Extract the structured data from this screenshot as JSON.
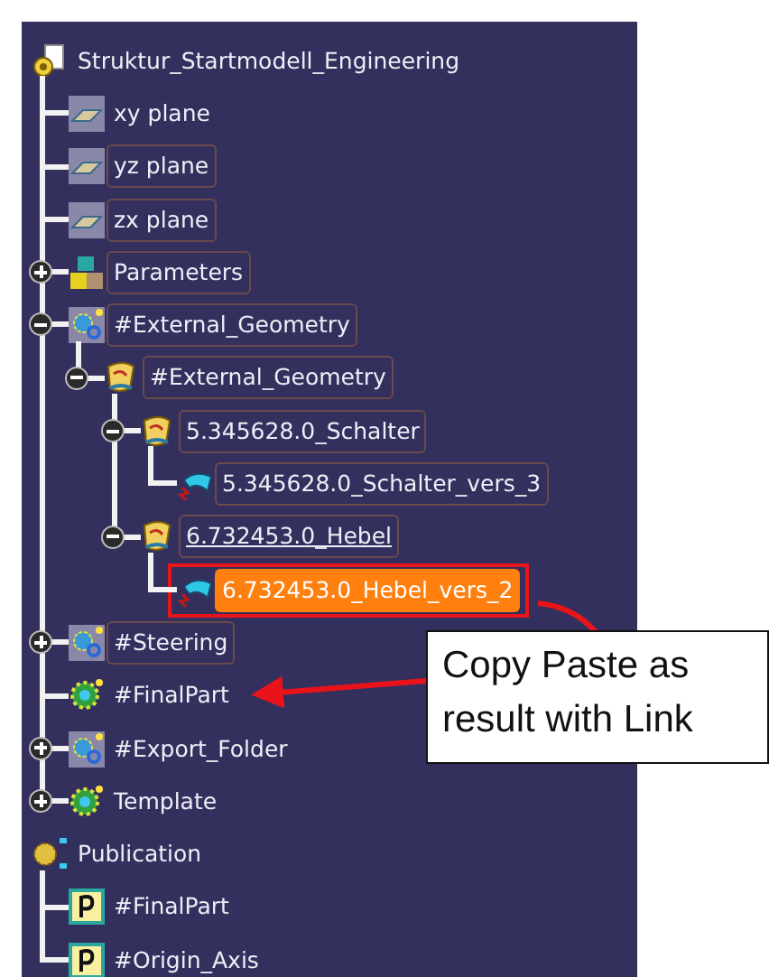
{
  "tree": [
    {
      "label": "Struktur_Startmodell_Engineering",
      "kind": "root",
      "framed": false,
      "selected": false,
      "children": [
        {
          "label": "xy plane",
          "kind": "plane",
          "framed": false,
          "selected": false
        },
        {
          "label": "yz plane",
          "kind": "plane",
          "framed": true,
          "selected": false
        },
        {
          "label": "zx plane",
          "kind": "plane",
          "framed": true,
          "selected": false
        },
        {
          "label": "Parameters",
          "kind": "parameters",
          "framed": true,
          "selected": false,
          "expanded": false
        },
        {
          "label": "#External_Geometry",
          "kind": "geoset",
          "framed": true,
          "selected": false,
          "expanded": true,
          "children": [
            {
              "label": "#External_Geometry",
              "kind": "body",
              "framed": true,
              "selected": false,
              "expanded": true,
              "children": [
                {
                  "label": "5.345628.0_Schalter",
                  "kind": "body",
                  "framed": true,
                  "selected": false,
                  "expanded": true,
                  "children": [
                    {
                      "label": "5.345628.0_Schalter_vers_3",
                      "kind": "surface",
                      "framed": true,
                      "selected": false
                    }
                  ]
                },
                {
                  "label": "6.732453.0_Hebel",
                  "kind": "body",
                  "framed": true,
                  "selected": false,
                  "current": true,
                  "expanded": true,
                  "children": [
                    {
                      "label": "6.732453.0_Hebel_vers_2",
                      "kind": "surface",
                      "framed": false,
                      "selected": true,
                      "marked": true
                    }
                  ]
                }
              ]
            }
          ]
        },
        {
          "label": "#Steering",
          "kind": "geoset",
          "framed": true,
          "selected": false,
          "expanded": false
        },
        {
          "label": "#FinalPart",
          "kind": "hybrid",
          "framed": false,
          "selected": false
        },
        {
          "label": "#Export_Folder",
          "kind": "geoset",
          "framed": false,
          "selected": false,
          "expanded": false
        },
        {
          "label": "Template",
          "kind": "hybrid",
          "framed": false,
          "selected": false,
          "expanded": false
        }
      ]
    },
    {
      "label": "Publication",
      "kind": "publication",
      "framed": false,
      "selected": false,
      "children": [
        {
          "label": "#FinalPart",
          "kind": "pub",
          "framed": false,
          "selected": false
        },
        {
          "label": "#Origin_Axis",
          "kind": "pub",
          "framed": false,
          "selected": false
        }
      ]
    }
  ],
  "callout": {
    "text": "Copy Paste as result with Link"
  }
}
